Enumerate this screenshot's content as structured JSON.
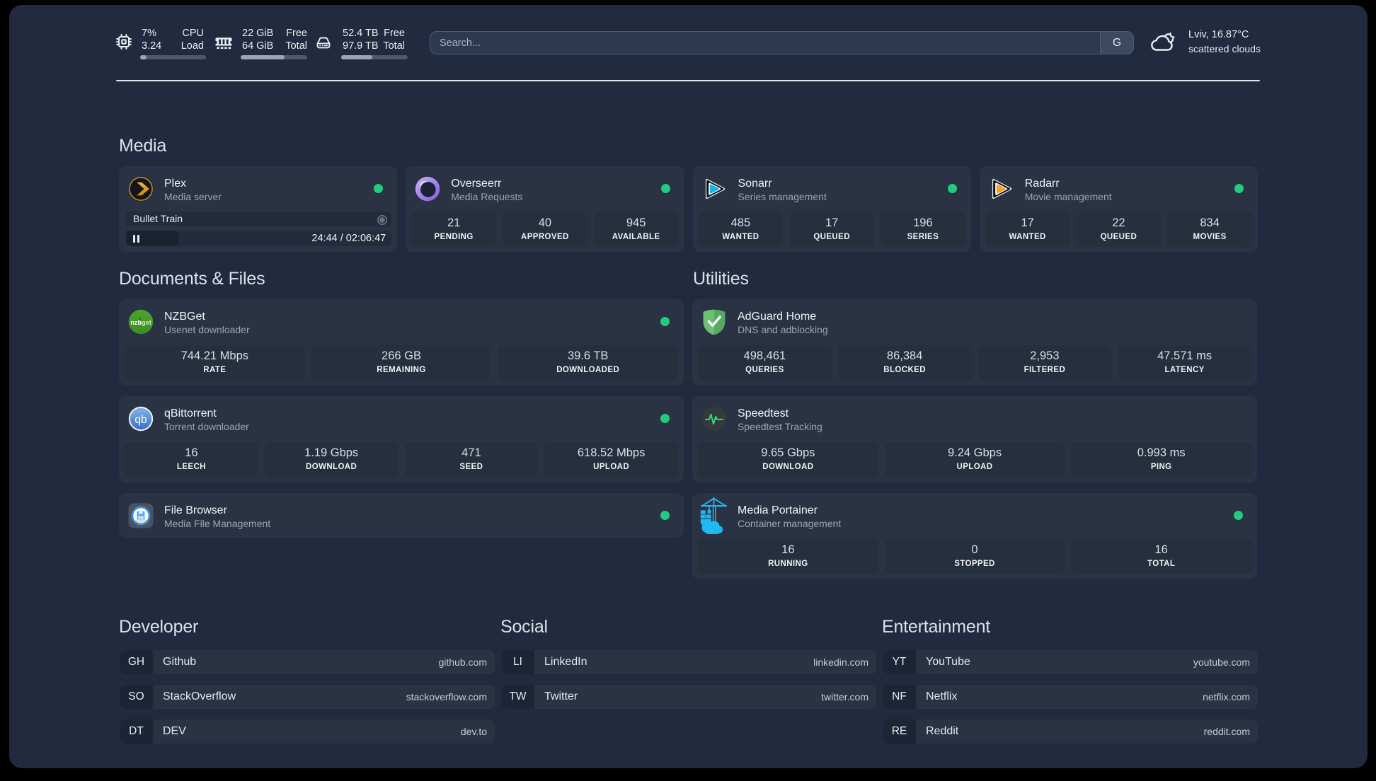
{
  "topbar": {
    "resources": [
      {
        "icon": "cpu-icon",
        "values": [
          "7%",
          "3.24"
        ],
        "labels": [
          "CPU",
          "Load"
        ],
        "progress_pct": 7
      },
      {
        "icon": "memory-icon",
        "values": [
          "22 GiB",
          "64 GiB"
        ],
        "labels": [
          "Free",
          "Total"
        ],
        "progress_pct": 65.6
      },
      {
        "icon": "disk-icon",
        "values": [
          "52.4 TB",
          "97.9 TB"
        ],
        "labels": [
          "Free",
          "Total"
        ],
        "progress_pct": 46.5
      }
    ],
    "search": {
      "placeholder": "Search...",
      "provider_button": "G"
    },
    "weather": {
      "icon": "cloud-moon-icon",
      "location": "Lviv, 16.87°C",
      "condition": "scattered clouds"
    }
  },
  "service_groups": [
    {
      "title": "Media",
      "services": [
        {
          "name": "Plex",
          "description": "Media server",
          "logo": "plex-logo",
          "online": true,
          "now_playing": {
            "title": "Bullet Train",
            "icon": "camera-lens-icon",
            "elapsed": "24:44",
            "separator": " / ",
            "duration": "02:06:47",
            "progress_pct": 19.7
          }
        },
        {
          "name": "Overseerr",
          "description": "Media Requests",
          "logo": "overseerr-logo",
          "online": true,
          "stats": [
            {
              "value": "21",
              "label": "PENDING"
            },
            {
              "value": "40",
              "label": "APPROVED"
            },
            {
              "value": "945",
              "label": "AVAILABLE"
            }
          ]
        },
        {
          "name": "Sonarr",
          "description": "Series management",
          "logo": "sonarr-logo",
          "online": true,
          "stats": [
            {
              "value": "485",
              "label": "WANTED"
            },
            {
              "value": "17",
              "label": "QUEUED"
            },
            {
              "value": "196",
              "label": "SERIES"
            }
          ]
        },
        {
          "name": "Radarr",
          "description": "Movie management",
          "logo": "radarr-logo",
          "online": true,
          "stats": [
            {
              "value": "17",
              "label": "WANTED"
            },
            {
              "value": "22",
              "label": "QUEUED"
            },
            {
              "value": "834",
              "label": "MOVIES"
            }
          ]
        }
      ]
    },
    {
      "title": "Documents & Files",
      "services": [
        {
          "name": "NZBGet",
          "description": "Usenet downloader",
          "logo": "nzbget-logo",
          "online": true,
          "stats": [
            {
              "value": "744.21 Mbps",
              "label": "RATE"
            },
            {
              "value": "266 GB",
              "label": "REMAINING"
            },
            {
              "value": "39.6 TB",
              "label": "DOWNLOADED"
            }
          ]
        },
        {
          "name": "qBittorrent",
          "description": "Torrent downloader",
          "logo": "qbittorrent-logo",
          "online": true,
          "stats": [
            {
              "value": "16",
              "label": "LEECH"
            },
            {
              "value": "1.19 Gbps",
              "label": "DOWNLOAD"
            },
            {
              "value": "471",
              "label": "SEED"
            },
            {
              "value": "618.52 Mbps",
              "label": "UPLOAD"
            }
          ]
        },
        {
          "name": "File Browser",
          "description": "Media File Management",
          "logo": "filebrowser-logo",
          "online": true
        }
      ]
    },
    {
      "title": "Utilities",
      "services": [
        {
          "name": "AdGuard Home",
          "description": "DNS and adblocking",
          "logo": "adguard-logo",
          "online": null,
          "stats": [
            {
              "value": "498,461",
              "label": "QUERIES"
            },
            {
              "value": "86,384",
              "label": "BLOCKED"
            },
            {
              "value": "2,953",
              "label": "FILTERED"
            },
            {
              "value": "47.571 ms",
              "label": "LATENCY"
            }
          ]
        },
        {
          "name": "Speedtest",
          "description": "Speedtest Tracking",
          "logo": "speedtest-logo",
          "online": null,
          "stats": [
            {
              "value": "9.65 Gbps",
              "label": "DOWNLOAD"
            },
            {
              "value": "9.24 Gbps",
              "label": "UPLOAD"
            },
            {
              "value": "0.993 ms",
              "label": "PING"
            }
          ]
        },
        {
          "name": "Media Portainer",
          "description": "Container management",
          "logo": "portainer-logo",
          "online": true,
          "stats": [
            {
              "value": "16",
              "label": "RUNNING"
            },
            {
              "value": "0",
              "label": "STOPPED"
            },
            {
              "value": "16",
              "label": "TOTAL"
            }
          ]
        }
      ]
    }
  ],
  "bookmark_groups": [
    {
      "title": "Developer",
      "items": [
        {
          "abbr": "GH",
          "name": "Github",
          "url": "github.com"
        },
        {
          "abbr": "SO",
          "name": "StackOverflow",
          "url": "stackoverflow.com"
        },
        {
          "abbr": "DT",
          "name": "DEV",
          "url": "dev.to"
        }
      ]
    },
    {
      "title": "Social",
      "items": [
        {
          "abbr": "LI",
          "name": "LinkedIn",
          "url": "linkedin.com"
        },
        {
          "abbr": "TW",
          "name": "Twitter",
          "url": "twitter.com"
        }
      ]
    },
    {
      "title": "Entertainment",
      "items": [
        {
          "abbr": "YT",
          "name": "YouTube",
          "url": "youtube.com"
        },
        {
          "abbr": "NF",
          "name": "Netflix",
          "url": "netflix.com"
        },
        {
          "abbr": "RE",
          "name": "Reddit",
          "url": "reddit.com"
        }
      ]
    }
  ]
}
